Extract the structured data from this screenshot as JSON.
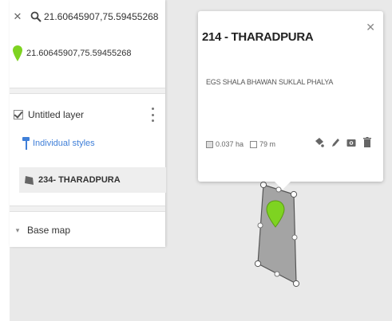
{
  "search": {
    "query": "21.60645907,75.59455268"
  },
  "result": {
    "coords": "21.60645907,75.59455268"
  },
  "layer": {
    "name": "Untitled layer",
    "styles_label": "Individual styles"
  },
  "feature": {
    "name": "234- THARADPURA"
  },
  "basemap": {
    "label": "Base map"
  },
  "popup": {
    "title": "214 - THARADPURA",
    "description": "EGS SHALA BHAWAN SUKLAL PHALYA",
    "area": "0.037 ha",
    "perimeter": "79 m"
  },
  "colors": {
    "pin": "#7ed321",
    "polygon": "#8c8c8c",
    "link": "#3f7fd8"
  }
}
